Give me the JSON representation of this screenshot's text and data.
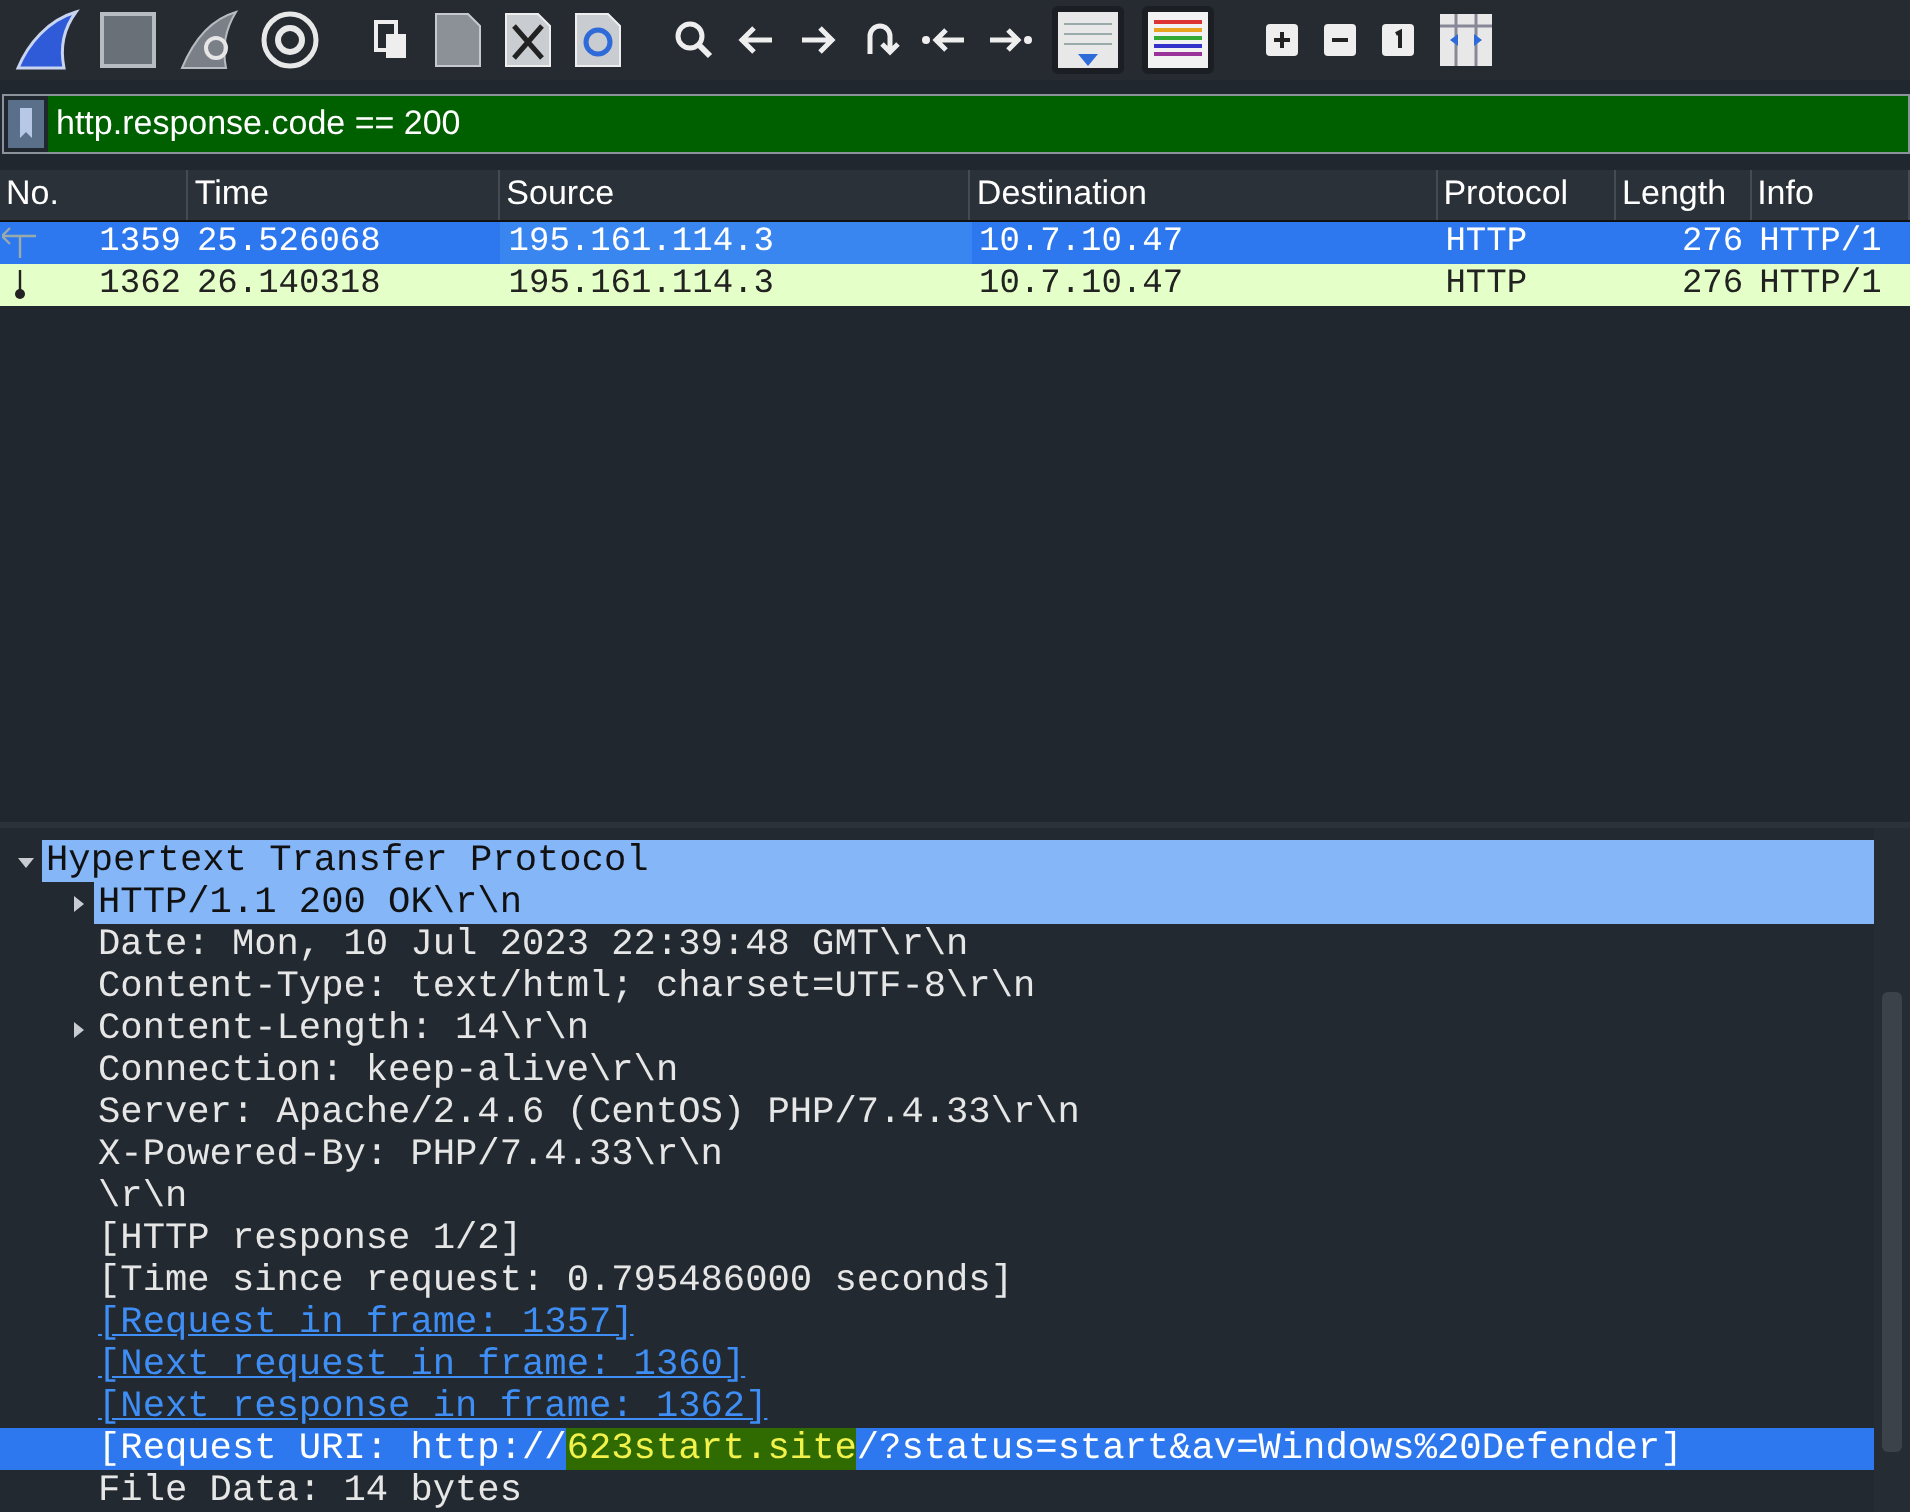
{
  "filter": {
    "value": "http.response.code == 200",
    "valid": true
  },
  "packet_list": {
    "columns": [
      "No.",
      "Time",
      "Source",
      "Destination",
      "Protocol",
      "Length",
      "Info"
    ],
    "rows": [
      {
        "cells": [
          "1359",
          "25.526068",
          "195.161.114.3",
          "10.7.10.47",
          "HTTP",
          "276",
          "HTTP/1"
        ],
        "selected": true,
        "kind": "request"
      },
      {
        "cells": [
          "1362",
          "26.140318",
          "195.161.114.3",
          "10.7.10.47",
          "HTTP",
          "276",
          "HTTP/1"
        ],
        "selected": false,
        "kind": "response"
      }
    ]
  },
  "details": [
    {
      "text": "Hypertext Transfer Protocol",
      "kind": "field",
      "expanded": true,
      "selected": false,
      "related": true,
      "children": [
        {
          "text": "HTTP/1.1 200 OK\\r\\n",
          "kind": "field",
          "expanded": false,
          "selected": false,
          "related": true
        },
        {
          "text": "Date: Mon, 10 Jul 2023 22:39:48 GMT\\r\\n",
          "kind": "field",
          "selected": false,
          "related": false
        },
        {
          "text": "Content-Type: text/html; charset=UTF-8\\r\\n",
          "kind": "field",
          "selected": false,
          "related": false
        },
        {
          "text": "Content-Length: 14\\r\\n",
          "kind": "field",
          "expanded": false,
          "selected": false,
          "related": false
        },
        {
          "text": "Connection: keep-alive\\r\\n",
          "kind": "field",
          "selected": false,
          "related": false
        },
        {
          "text": "Server: Apache/2.4.6 (CentOS) PHP/7.4.33\\r\\n",
          "kind": "field",
          "selected": false,
          "related": false
        },
        {
          "text": "X-Powered-By: PHP/7.4.33\\r\\n",
          "kind": "field",
          "selected": false,
          "related": false
        },
        {
          "text": "\\r\\n",
          "kind": "field",
          "selected": false,
          "related": false
        },
        {
          "text": "[HTTP response 1/2]",
          "kind": "field",
          "selected": false,
          "related": false
        },
        {
          "text": "[Time since request: 0.795486000 seconds]",
          "kind": "field",
          "selected": false,
          "related": false
        },
        {
          "text": "[Request in frame: 1357]",
          "kind": "link",
          "selected": false,
          "related": false
        },
        {
          "text": "[Next request in frame: 1360]",
          "kind": "link",
          "selected": false,
          "related": false
        },
        {
          "text": "[Next response in frame: 1362]",
          "kind": "link",
          "selected": false,
          "related": false
        },
        {
          "parts": [
            "[Request URI: http://",
            "623start.site",
            "/?status=start&av=Windows%20Defender]"
          ],
          "kind": "match",
          "selected": true,
          "related": false
        },
        {
          "text": "File Data: 14 bytes",
          "kind": "field",
          "selected": false,
          "related": false
        }
      ]
    }
  ]
}
